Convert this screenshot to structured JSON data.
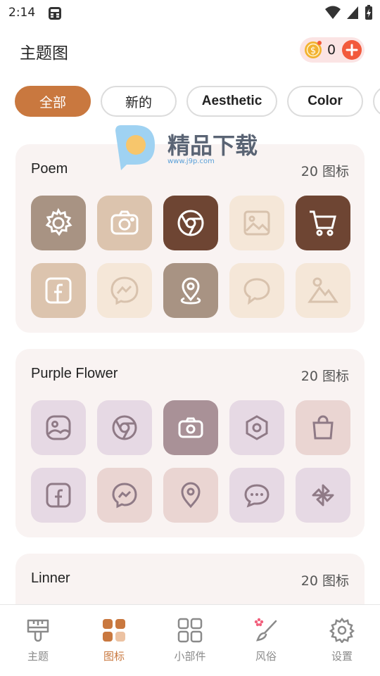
{
  "status_bar": {
    "time": "2:14"
  },
  "header": {
    "title": "主题图",
    "coins": "0"
  },
  "chips": [
    {
      "label": "全部",
      "active": true
    },
    {
      "label": "新的",
      "active": false
    },
    {
      "label": "Aesthetic",
      "active": false
    },
    {
      "label": "Color",
      "active": false
    }
  ],
  "watermark": {
    "text": "精品下载",
    "url": "www.j9p.com"
  },
  "cards": [
    {
      "title": "Poem",
      "count": "20 图标",
      "icons": [
        {
          "name": "settings-gear-icon",
          "bg": "#a89383",
          "fg": "#ffffff"
        },
        {
          "name": "camera-icon",
          "bg": "#dcc4ae",
          "fg": "#ffffff"
        },
        {
          "name": "chrome-browser-icon",
          "bg": "#6e4533",
          "fg": "#ffffff"
        },
        {
          "name": "gallery-image-icon",
          "bg": "#f5e7d8",
          "fg": "#d8c2ad"
        },
        {
          "name": "shopping-cart-icon",
          "bg": "#6e4533",
          "fg": "#ffffff"
        },
        {
          "name": "facebook-icon",
          "bg": "#dcc4ae",
          "fg": "#ffffff"
        },
        {
          "name": "messenger-icon",
          "bg": "#f5e7d8",
          "fg": "#d8c2ad"
        },
        {
          "name": "maps-location-icon",
          "bg": "#a89383",
          "fg": "#ffffff"
        },
        {
          "name": "message-bubble-icon",
          "bg": "#f5e7d8",
          "fg": "#d8c2ad"
        },
        {
          "name": "photos-mountain-icon",
          "bg": "#f5e7d8",
          "fg": "#d8c2ad"
        }
      ]
    },
    {
      "title": "Purple Flower",
      "count": "20 图标",
      "icons": [
        {
          "name": "gallery-image-icon",
          "bg": "#e6d9e4",
          "fg": "#8f7a86"
        },
        {
          "name": "chrome-browser-icon",
          "bg": "#e6d9e4",
          "fg": "#8f7a86"
        },
        {
          "name": "camera-icon",
          "bg": "#a99197",
          "fg": "#ffffff"
        },
        {
          "name": "settings-hexagon-icon",
          "bg": "#e6d9e4",
          "fg": "#8f7a86"
        },
        {
          "name": "shopping-bag-icon",
          "bg": "#ead5d2",
          "fg": "#8f7a86"
        },
        {
          "name": "facebook-icon",
          "bg": "#e6d9e4",
          "fg": "#8f7a86"
        },
        {
          "name": "messenger-icon",
          "bg": "#ead5d2",
          "fg": "#8f7a86"
        },
        {
          "name": "maps-location-icon",
          "bg": "#ead5d2",
          "fg": "#8f7a86"
        },
        {
          "name": "chat-dots-icon",
          "bg": "#e6d9e4",
          "fg": "#8f7a86"
        },
        {
          "name": "pinwheel-icon",
          "bg": "#e6d9e4",
          "fg": "#8f7a86"
        }
      ]
    },
    {
      "title": "Linner",
      "count": "20 图标",
      "icons": []
    }
  ],
  "bottom_nav": [
    {
      "label": "主题",
      "icon": "brush-icon",
      "active": false
    },
    {
      "label": "图标",
      "icon": "grid-icon",
      "active": true
    },
    {
      "label": "小部件",
      "icon": "widgets-icon",
      "active": false
    },
    {
      "label": "风俗",
      "icon": "paintbrush-flower-icon",
      "active": false
    },
    {
      "label": "设置",
      "icon": "settings-icon",
      "active": false
    }
  ]
}
